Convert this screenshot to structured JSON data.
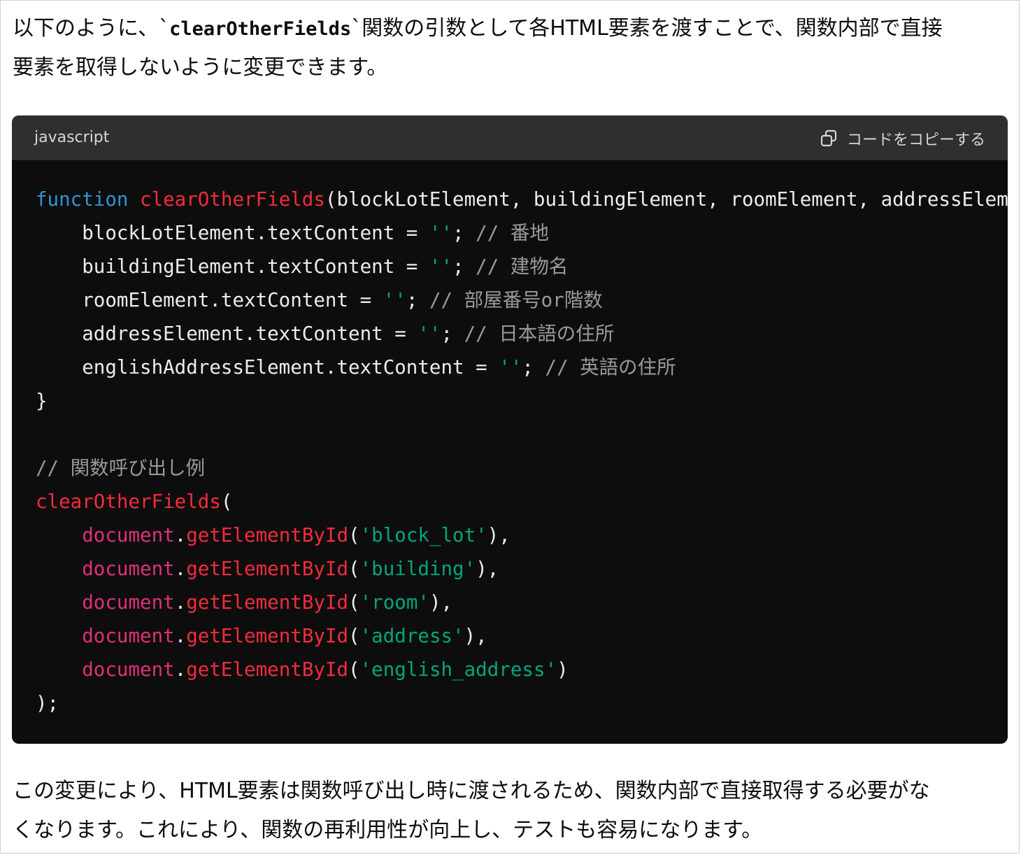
{
  "intro": {
    "line1_before": "以下のように、`",
    "line1_code": "clearOtherFields",
    "line1_after": "`関数の引数として各HTML要素を渡すことで、関数内部で直接",
    "line2": "要素を取得しないように変更できます。"
  },
  "code": {
    "language": "javascript",
    "copy_label": "コードをコピーする",
    "l1_kw": "function",
    "l1_fn": "clearOtherFields",
    "l1_rest": "(blockLotElement, buildingElement, roomElement, addressElement, englishAddressElement) {",
    "l2_code": "    blockLotElement.textContent = ",
    "l2_str": "''",
    "l2_semi": "; ",
    "l2_cm": "// 番地",
    "l3_code": "    buildingElement.textContent = ",
    "l3_str": "''",
    "l3_semi": "; ",
    "l3_cm": "// 建物名",
    "l4_code": "    roomElement.textContent = ",
    "l4_str": "''",
    "l4_semi": "; ",
    "l4_cm": "// 部屋番号or階数",
    "l5_code": "    addressElement.textContent = ",
    "l5_str": "''",
    "l5_semi": "; ",
    "l5_cm": "// 日本語の住所",
    "l6_code": "    englishAddressElement.textContent = ",
    "l6_str": "''",
    "l6_semi": "; ",
    "l6_cm": "// 英語の住所",
    "l7": "}",
    "l9_cm": "// 関数呼び出し例",
    "l10_fn": "clearOtherFields",
    "l10_paren": "(",
    "indent": "    ",
    "obj": "document",
    "dot": ".",
    "method": "getElementById",
    "open": "(",
    "l11_str": "'block_lot'",
    "l12_str": "'building'",
    "l13_str": "'room'",
    "l14_str": "'address'",
    "l15_str": "'english_address'",
    "close_comma": "),",
    "close_last": ")",
    "l16": ");"
  },
  "outro": {
    "line1": "この変更により、HTML要素は関数呼び出し時に渡されるため、関数内部で直接取得する必要がな",
    "line2": "くなります。これにより、関数の再利用性が向上し、テストも容易になります。"
  },
  "icons": {
    "copy": "copy-icon"
  }
}
